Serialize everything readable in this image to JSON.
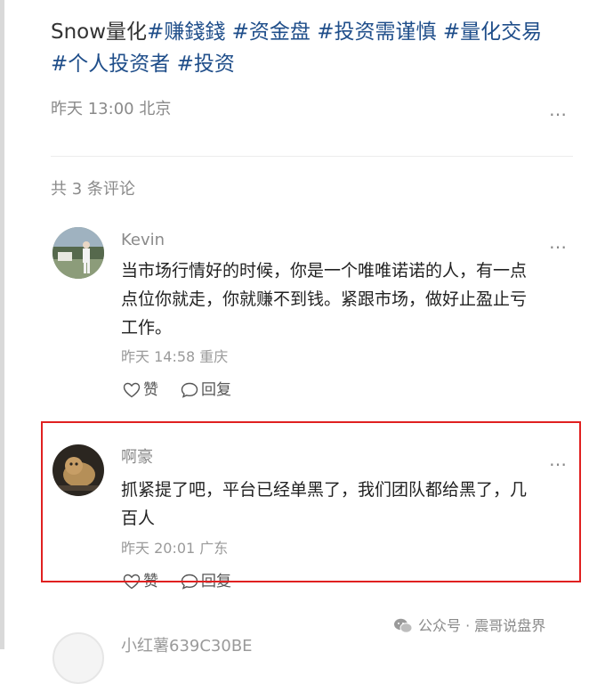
{
  "post": {
    "title_parts": [
      {
        "text": "Snow量化",
        "hashtag": false
      },
      {
        "text": "#赚錢錢 ",
        "hashtag": true
      },
      {
        "text": "#资金盘 ",
        "hashtag": true
      },
      {
        "text": "#投资需谨慎 ",
        "hashtag": true
      },
      {
        "text": "#量化交易 ",
        "hashtag": true
      },
      {
        "text": "#个人投资者 ",
        "hashtag": true
      },
      {
        "text": "#投资",
        "hashtag": true
      }
    ],
    "meta": "昨天 13:00 北京",
    "more_icon": "…",
    "comment_count": "共 3 条评论"
  },
  "comments": [
    {
      "name": "Kevin",
      "text_lines": [
        "当市场行情好的时候，你是一个唯唯诺诺的人，有一点",
        "点位你就走，你就赚不到钱。紧跟市场，做好止盈止亏",
        "工作。"
      ],
      "meta": "昨天 14:58 重庆",
      "like_label": "赞",
      "reply_label": "回复",
      "more_icon": "…"
    },
    {
      "name": "啊豪",
      "text_lines": [
        "抓紧提了吧，平台已经单黑了，我们团队都给黑了，几",
        "百人"
      ],
      "meta": "昨天 20:01 广东",
      "like_label": "赞",
      "reply_label": "回复",
      "more_icon": "…"
    },
    {
      "name": "小红薯639C30BE"
    }
  ],
  "watermark": {
    "text": "公众号 · 震哥说盘界",
    "icon": "wechat-icon"
  },
  "colors": {
    "hashtag": "#1f4e8a",
    "highlight": "#e02020",
    "muted": "#8a8a8a"
  }
}
